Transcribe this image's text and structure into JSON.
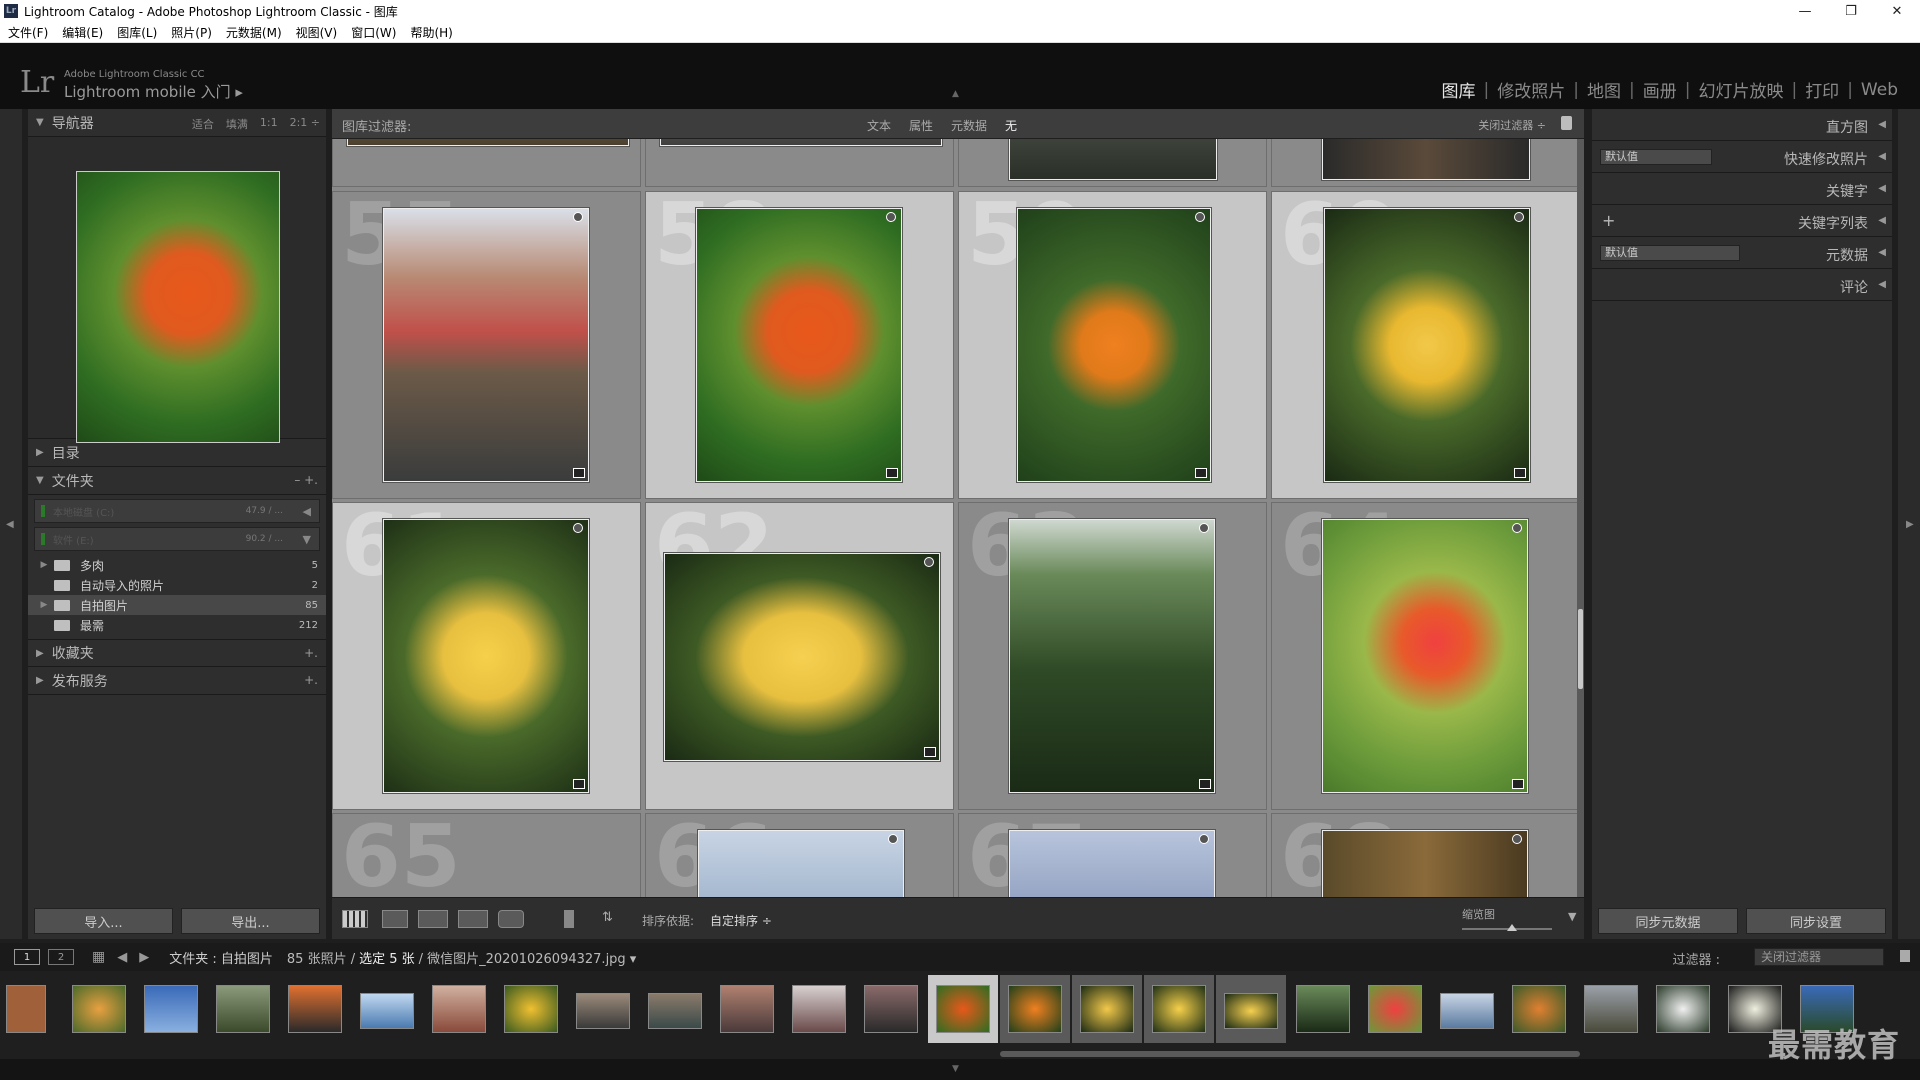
{
  "window": {
    "title": "Lightroom Catalog - Adobe Photoshop Lightroom Classic - 图库",
    "app_icon": "Lr",
    "controls": [
      "—",
      "❐",
      "✕"
    ]
  },
  "menu": [
    "文件(F)",
    "编辑(E)",
    "图库(L)",
    "照片(P)",
    "元数据(M)",
    "视图(V)",
    "窗口(W)",
    "帮助(H)"
  ],
  "identity": {
    "logo": "Lr",
    "line1": "Adobe Lightroom Classic CC",
    "line2": "Lightroom mobile 入门 ▸"
  },
  "modules": [
    {
      "label": "图库",
      "active": true
    },
    {
      "label": "修改照片"
    },
    {
      "label": "地图"
    },
    {
      "label": "画册"
    },
    {
      "label": "幻灯片放映"
    },
    {
      "label": "打印"
    },
    {
      "label": "Web"
    }
  ],
  "left_panel": {
    "navigator": {
      "title": "导航器",
      "options": [
        "适合",
        "填满",
        "1:1",
        "2:1 ÷"
      ]
    },
    "catalog": {
      "title": "目录"
    },
    "folders": {
      "title": "文件夹",
      "actions": "–  +.",
      "drives": [
        {
          "name": "本地磁盘 (C:)",
          "cap": "47.9 / ..."
        },
        {
          "name": "软件 (E:)",
          "cap": "90.2 / ..."
        }
      ],
      "items": [
        {
          "label": "多肉",
          "count": "5",
          "expand": "▶"
        },
        {
          "label": "自动导入的照片",
          "count": "2",
          "expand": ""
        },
        {
          "label": "自拍图片",
          "count": "85",
          "expand": "▶",
          "selected": true
        },
        {
          "label": "最需",
          "count": "212",
          "expand": ""
        }
      ]
    },
    "collections": {
      "title": "收藏夹",
      "action": "+."
    },
    "publish": {
      "title": "发布服务",
      "action": "+."
    },
    "buttons": {
      "import": "导入...",
      "export": "导出..."
    }
  },
  "filter_bar": {
    "label": "图库过滤器:",
    "options": [
      "文本",
      "属性",
      "元数据",
      "无"
    ],
    "active": "无",
    "close": "关闭过滤器 ÷"
  },
  "grid": {
    "cells": [
      {
        "num": "55",
        "selected": false
      },
      {
        "num": "58",
        "selected": true
      },
      {
        "num": "59",
        "selected": true
      },
      {
        "num": "60",
        "selected": true
      },
      {
        "num": "61",
        "selected": true
      },
      {
        "num": "62",
        "selected": true
      },
      {
        "num": "63",
        "selected": false
      },
      {
        "num": "64",
        "selected": false
      },
      {
        "num": "65",
        "selected": false
      },
      {
        "num": "66",
        "selected": false
      },
      {
        "num": "67",
        "selected": false
      },
      {
        "num": "68",
        "selected": false
      }
    ]
  },
  "toolbar": {
    "sort_label": "排序依据:",
    "sort_value": "自定排序 ÷",
    "zoom_label": "缩览图",
    "zoom_level": 0.55
  },
  "right_panel": {
    "histogram": "直方图",
    "quick_develop": "快速修改照片",
    "keywords": "关键字",
    "keyword_list": "关键字列表",
    "metadata": "元数据",
    "comments": "评论",
    "preset": "默认值",
    "buttons": {
      "sync_meta": "同步元数据",
      "sync_settings": "同步设置"
    }
  },
  "filmstrip_header": {
    "source": "文件夹 : 自拍图片",
    "count": "85 张照片 /",
    "selected": "选定 5 张",
    "file": "/ 微信图片_20201026094327.jpg ▾",
    "filter_label": "过滤器 :",
    "filter_value": "关闭过滤器"
  },
  "watermark": "最需教育",
  "colors": {
    "accent": "#c8c8c8",
    "panel": "#2e2e2e",
    "grid": "#8a8a8a"
  }
}
